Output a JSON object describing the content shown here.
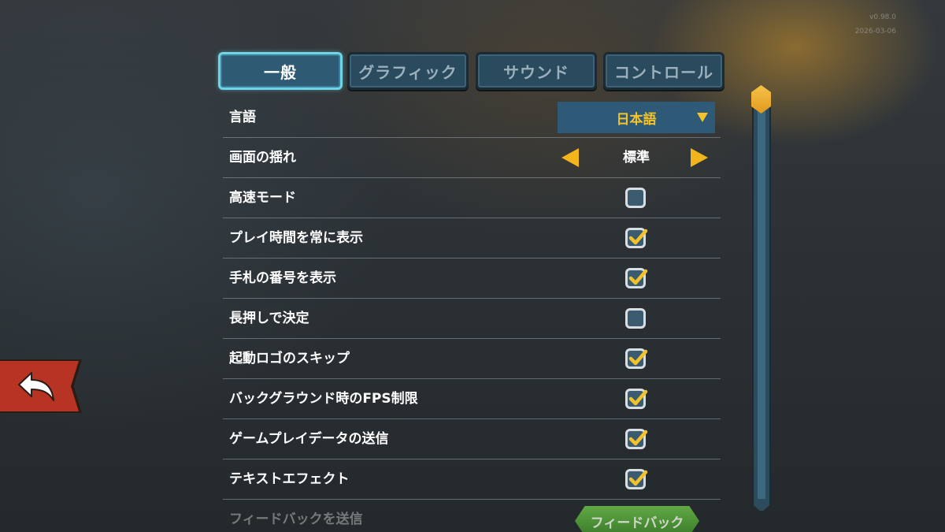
{
  "version": {
    "number": "v0.98.0",
    "date": "2026-03-06"
  },
  "tabs": [
    {
      "label": "一般",
      "active": true
    },
    {
      "label": "グラフィック",
      "active": false
    },
    {
      "label": "サウンド",
      "active": false
    },
    {
      "label": "コントロール",
      "active": false
    }
  ],
  "settings": {
    "language": {
      "label": "言語",
      "value": "日本語"
    },
    "screen_shake": {
      "label": "画面の揺れ",
      "value": "標準"
    },
    "fast_mode": {
      "label": "高速モード",
      "checked": false
    },
    "show_playtime": {
      "label": "プレイ時間を常に表示",
      "checked": true
    },
    "show_hand_numbers": {
      "label": "手札の番号を表示",
      "checked": true
    },
    "long_press_confirm": {
      "label": "長押しで決定",
      "checked": false
    },
    "skip_logo": {
      "label": "起動ロゴのスキップ",
      "checked": true
    },
    "bg_fps_limit": {
      "label": "バックグラウンド時のFPS制限",
      "checked": true
    },
    "send_gameplay_data": {
      "label": "ゲームプレイデータの送信",
      "checked": true
    },
    "text_effects": {
      "label": "テキストエフェクト",
      "checked": true
    },
    "feedback": {
      "label": "フィードバックを送信",
      "button": "フィードバック"
    }
  },
  "scrollbar": {
    "position": 0
  },
  "colors": {
    "accent_yellow": "#f3c22b",
    "tab_active_border": "#6ed4e6",
    "back_red": "#b73424",
    "feedback_green": "#56a83a"
  },
  "icons": {
    "back": "undo-arrow-icon",
    "dropdown": "triangle-down-icon",
    "prev": "triangle-left-icon",
    "next": "triangle-right-icon",
    "check": "checkmark-icon"
  }
}
